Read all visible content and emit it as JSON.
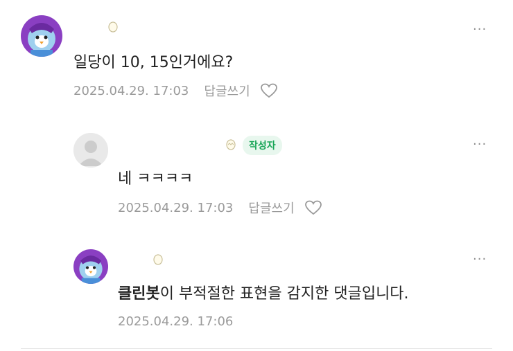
{
  "comments": [
    {
      "text": "일당이 10, 15인거에요?",
      "date": "2025.04.29. 17:03",
      "reply_label": "답글쓰기",
      "more_label": "···"
    },
    {
      "text": "네 ㅋㅋㅋㅋ",
      "date": "2025.04.29. 17:03",
      "reply_label": "답글쓰기",
      "author_badge": "작성자",
      "more_label": "···"
    },
    {
      "cleanbot_label": "클린봇",
      "text": "이 부적절한 표현을 감지한 댓글입니다.",
      "date": "2025.04.29. 17:06",
      "more_label": "···"
    }
  ],
  "icons": {
    "level_badge": "egg-icon",
    "like": "heart-icon",
    "more": "more-icon"
  },
  "colors": {
    "author_badge_bg": "#e8f7ee",
    "author_badge_text": "#18a557",
    "meta_text": "#9a9a9a",
    "avatar_purple": "#8a3fc2"
  }
}
